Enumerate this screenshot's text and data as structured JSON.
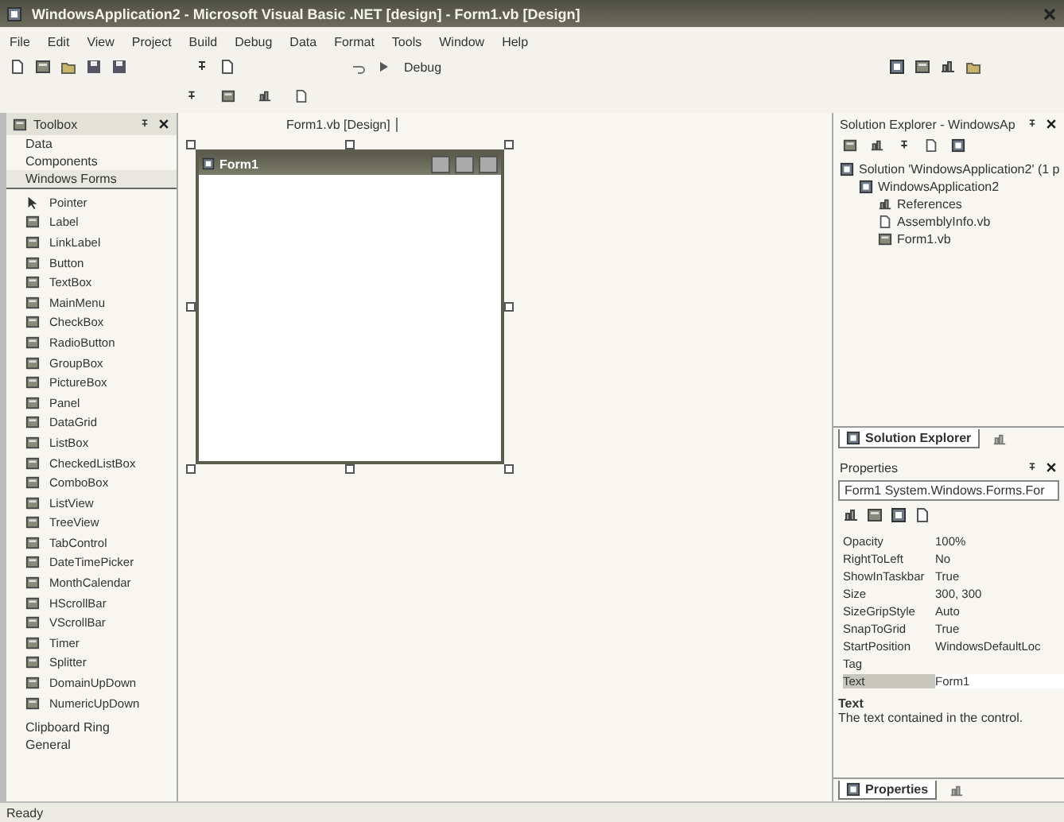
{
  "window": {
    "title": "WindowsApplication2 - Microsoft Visual Basic .NET [design] - Form1.vb [Design]"
  },
  "menu": [
    "File",
    "Edit",
    "View",
    "Project",
    "Build",
    "Debug",
    "Data",
    "Format",
    "Tools",
    "Window",
    "Help"
  ],
  "toolbar": {
    "configuration": "Debug"
  },
  "toolbox": {
    "title": "Toolbox",
    "categories": [
      {
        "label": "Data",
        "selected": false
      },
      {
        "label": "Components",
        "selected": false
      },
      {
        "label": "Windows Forms",
        "selected": true
      }
    ],
    "items": [
      "Pointer",
      "Label",
      "LinkLabel",
      "Button",
      "TextBox",
      "MainMenu",
      "CheckBox",
      "RadioButton",
      "GroupBox",
      "PictureBox",
      "Panel",
      "DataGrid",
      "ListBox",
      "CheckedListBox",
      "ComboBox",
      "ListView",
      "TreeView",
      "TabControl",
      "DateTimePicker",
      "MonthCalendar",
      "HScrollBar",
      "VScrollBar",
      "Timer",
      "Splitter",
      "DomainUpDown",
      "NumericUpDown"
    ],
    "bottom_categories": [
      {
        "label": "Clipboard Ring",
        "selected": false
      },
      {
        "label": "General",
        "selected": false
      }
    ]
  },
  "designer": {
    "tab": "Form1.vb [Design]",
    "form_title": "Form1"
  },
  "solution_explorer": {
    "title": "Solution Explorer - WindowsAp",
    "tree": [
      {
        "label": "Solution 'WindowsApplication2' (1 p",
        "kind": "solution",
        "children": [
          {
            "label": "WindowsApplication2",
            "kind": "project",
            "children": [
              {
                "label": "References",
                "kind": "references"
              },
              {
                "label": "AssemblyInfo.vb",
                "kind": "file"
              },
              {
                "label": "Form1.vb",
                "kind": "form"
              }
            ]
          }
        ]
      }
    ],
    "tabs": [
      {
        "label": "Solution Explorer",
        "selected": true
      },
      {
        "selected": false
      }
    ]
  },
  "properties": {
    "title": "Properties",
    "object": "Form1  System.Windows.Forms.For",
    "rows": [
      {
        "name": "Opacity",
        "value": "100%",
        "selected": false
      },
      {
        "name": "RightToLeft",
        "value": "No",
        "selected": false
      },
      {
        "name": "ShowInTaskbar",
        "value": "True",
        "selected": false
      },
      {
        "name": "Size",
        "value": "300, 300",
        "selected": false
      },
      {
        "name": "SizeGripStyle",
        "value": "Auto",
        "selected": false
      },
      {
        "name": "SnapToGrid",
        "value": "True",
        "selected": false
      },
      {
        "name": "StartPosition",
        "value": "WindowsDefaultLoc",
        "selected": false
      },
      {
        "name": "Tag",
        "selected": false
      },
      {
        "name": "Text",
        "value": "Form1",
        "selected": true
      }
    ],
    "description": {
      "title": "Text",
      "text": "The text contained in the control."
    },
    "tabs": [
      {
        "label": "Properties",
        "selected": true
      },
      {
        "selected": false
      }
    ]
  },
  "status_bar": {
    "text": "Ready"
  }
}
